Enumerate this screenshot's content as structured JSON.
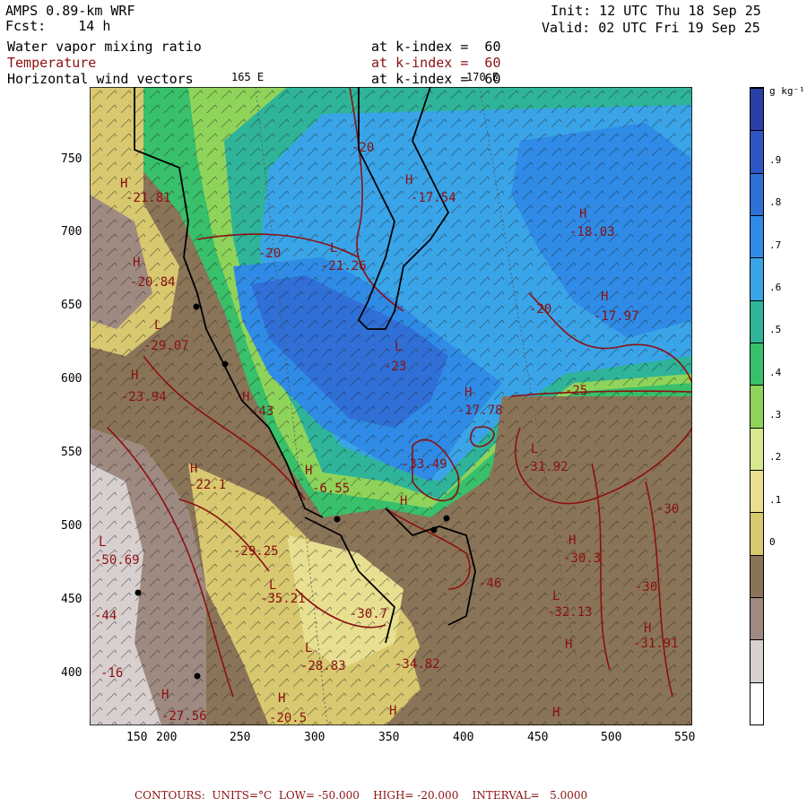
{
  "header": {
    "model": "AMPS 0.89-km WRF",
    "forecast": "Fcst:    14 h",
    "init": "Init: 12 UTC Thu 18 Sep 25",
    "valid": "Valid: 02 UTC Fri 19 Sep 25",
    "field1": "Water vapor mixing ratio",
    "field2": "Temperature",
    "field3": "Horizontal wind vectors",
    "level1": "at k-index =  60",
    "level2": "at k-index =  60",
    "level3": "at k-index =  60",
    "lon_label_1": "165 E",
    "lon_label_2": "170 E"
  },
  "axes": {
    "x_ticks": [
      "150",
      "200",
      "250",
      "300",
      "350",
      "400",
      "450",
      "500",
      "550"
    ],
    "y_ticks": [
      "750",
      "700",
      "650",
      "600",
      "550",
      "500",
      "450",
      "400"
    ]
  },
  "colorbar": {
    "unit": "g kg⁻¹",
    "labels": [
      ".9",
      ".8",
      ".7",
      ".6",
      ".5",
      ".4",
      ".3",
      ".2",
      ".1",
      "0"
    ],
    "colors": [
      "#2a3fa8",
      "#2f56c2",
      "#2f6fd6",
      "#2f8be6",
      "#3aa4e8",
      "#2fb49a",
      "#38c06a",
      "#8fd45a",
      "#d8e890",
      "#e8e090",
      "#d8c870",
      "#8a7458",
      "#9e8a80",
      "#d8cfcf",
      "#ffffff"
    ]
  },
  "labels": [
    {
      "text": "H",
      "name": "high-label"
    },
    {
      "text": "-21.81"
    },
    {
      "text": "-20.84"
    },
    {
      "text": "-29.07"
    },
    {
      "text": "-23.94"
    },
    {
      "text": "-22.1"
    },
    {
      "text": "-29.25"
    },
    {
      "text": "-35.21"
    },
    {
      "text": "-30.7"
    },
    {
      "text": "-28.83"
    },
    {
      "text": "-20.5"
    },
    {
      "text": "-34.82"
    },
    {
      "text": "-27.56"
    },
    {
      "text": "-16"
    },
    {
      "text": "-44"
    },
    {
      "text": "-50.69"
    },
    {
      "text": "-21.26"
    },
    {
      "text": "-17.54"
    },
    {
      "text": "-18.03"
    },
    {
      "text": "-17.97"
    },
    {
      "text": "-23"
    },
    {
      "text": "-17.78"
    },
    {
      "text": "-31.92"
    },
    {
      "text": "-30.3"
    },
    {
      "text": "-32.13"
    },
    {
      "text": "-31.91"
    },
    {
      "text": "-33.49"
    },
    {
      "text": "-6.55"
    },
    {
      "text": "-20"
    },
    {
      "text": "-25"
    },
    {
      "text": "-30"
    },
    {
      "text": "-43"
    },
    {
      "text": "-46"
    }
  ],
  "footer": "CONTOURS:  UNITS=°C  LOW= -50.000    HIGH= -20.000    INTERVAL=   5.0000"
}
